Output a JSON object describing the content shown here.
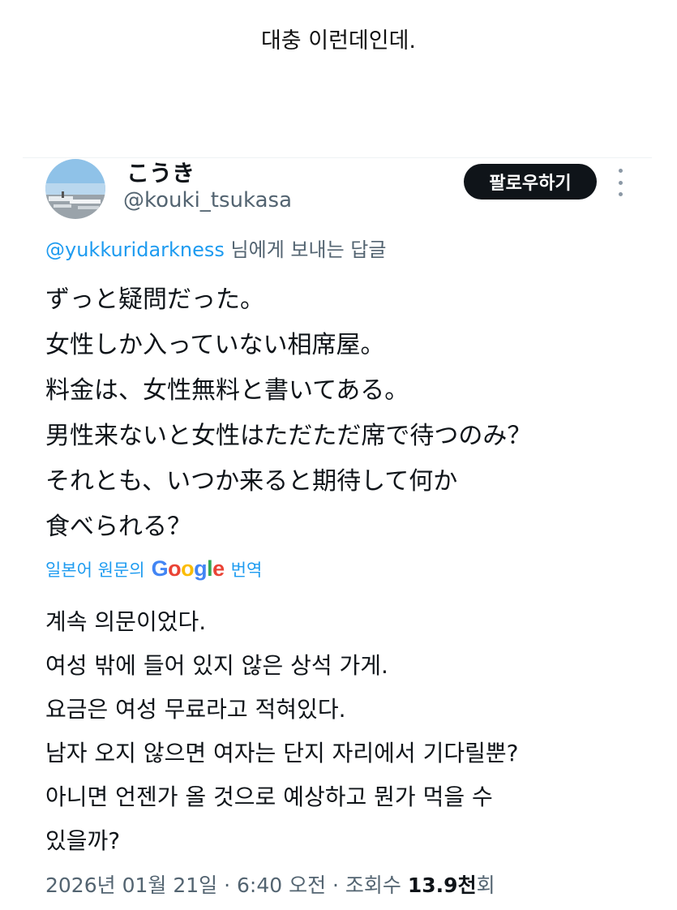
{
  "caption": "대충 이런데인데.",
  "tweet": {
    "display_name": "こうき",
    "handle": "@kouki_tsukasa",
    "follow_label": "팔로우하기",
    "reply_to": {
      "mention": "@yukkuridarkness",
      "suffix": " 님에게 보내는 답글"
    },
    "original_lines": [
      "ずっと疑問だった。",
      "女性しか入っていない相席屋。",
      "料金は、女性無料と書いてある。",
      "男性来ないと女性はただただ席で待つのみ？",
      "それとも、いつか来ると期待して何か",
      "食べられる？"
    ],
    "translate": {
      "prefix": "일본어 원문의",
      "brand": "Google",
      "suffix": "번역"
    },
    "translated_lines": [
      "계속 의문이었다.",
      "여성 밖에 들어 있지 않은 상석 가게.",
      "요금은 여성 무료라고 적혀있다.",
      "남자 오지 않으면 여자는 단지 자리에서 기다릴뿐?",
      "아니면 언젠가 올 것으로 예상하고 뭔가 먹을 수",
      "있을까?"
    ],
    "meta": {
      "date": "2026년 01월 21일",
      "time": "6:40 오전",
      "views_label": "조회수",
      "views_count": "13.9천",
      "views_unit": "회",
      "separator": " · "
    }
  }
}
